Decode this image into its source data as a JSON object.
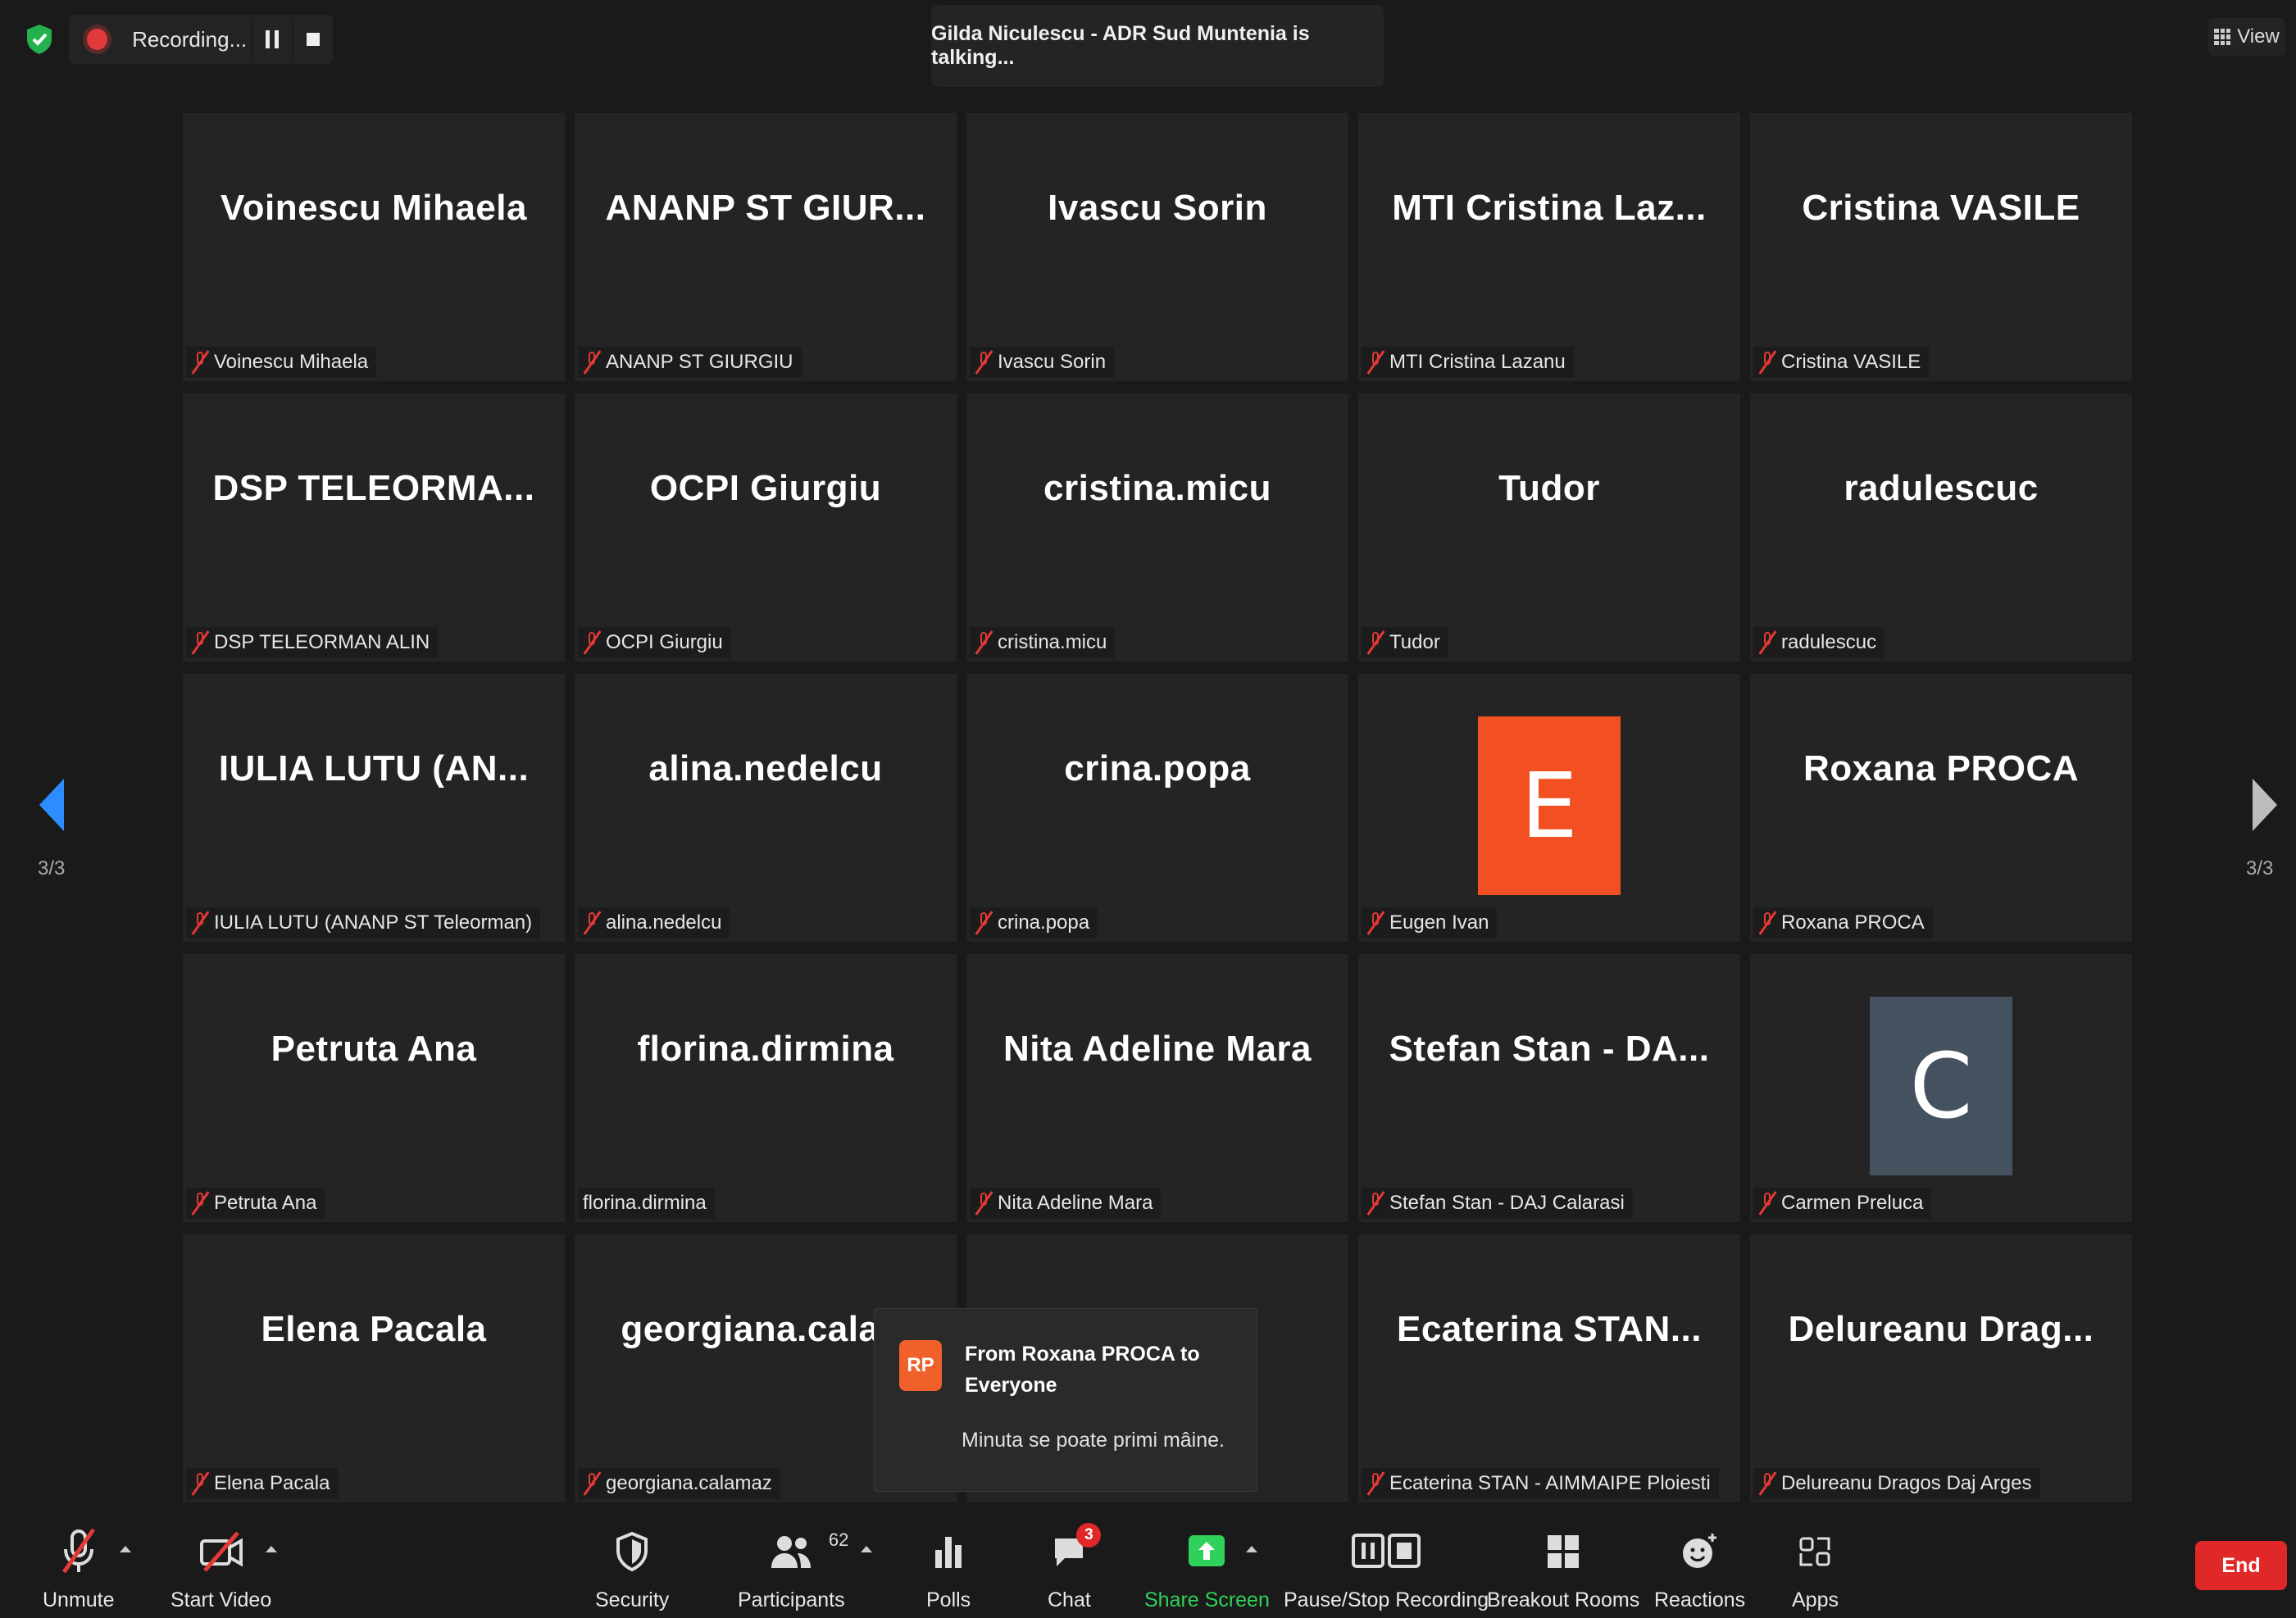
{
  "topbar": {
    "recording_label": "Recording...",
    "talking_banner": "Gilda Niculescu - ADR Sud Muntenia is talking...",
    "view_label": "View"
  },
  "navigation": {
    "left_page": "3/3",
    "right_page": "3/3"
  },
  "colors": {
    "accent_blue": "#2d8cff",
    "muted_red": "#e53935",
    "share_green": "#2fd15a",
    "end_red": "#e02828",
    "avatar_e": "#f25022",
    "avatar_c": "#44525f",
    "rp_badge": "#f0602a"
  },
  "tiles": [
    {
      "display": "Voinescu Mihaela",
      "tag": "Voinescu Mihaela",
      "muted": true
    },
    {
      "display": "ANANP ST GIUR...",
      "tag": "ANANP ST GIURGIU",
      "muted": true
    },
    {
      "display": "Ivascu Sorin",
      "tag": "Ivascu Sorin",
      "muted": true
    },
    {
      "display": "MTI Cristina Laz...",
      "tag": "MTI Cristina Lazanu",
      "muted": true
    },
    {
      "display": "Cristina VASILE",
      "tag": "Cristina VASILE",
      "muted": true
    },
    {
      "display": "DSP TELEORMA...",
      "tag": "DSP TELEORMAN ALIN",
      "muted": true
    },
    {
      "display": "OCPI Giurgiu",
      "tag": "OCPI Giurgiu",
      "muted": true
    },
    {
      "display": "cristina.micu",
      "tag": "cristina.micu",
      "muted": true
    },
    {
      "display": "Tudor",
      "tag": "Tudor",
      "muted": true
    },
    {
      "display": "radulescuc",
      "tag": "radulescuc",
      "muted": true
    },
    {
      "display": "IULIA LUTU (AN...",
      "tag": "IULIA LUTU (ANANP ST Teleorman)",
      "muted": true
    },
    {
      "display": "alina.nedelcu",
      "tag": "alina.nedelcu",
      "muted": true
    },
    {
      "display": "crina.popa",
      "tag": "crina.popa",
      "muted": true
    },
    {
      "avatar": "E",
      "avatar_color": "#f25022",
      "tag": "Eugen Ivan",
      "muted": true
    },
    {
      "display": "Roxana PROCA",
      "tag": "Roxana PROCA",
      "muted": true
    },
    {
      "display": "Petruta Ana",
      "tag": "Petruta Ana",
      "muted": true
    },
    {
      "display": "florina.dirmina",
      "tag": "florina.dirmina",
      "muted": false
    },
    {
      "display": "Nita Adeline Mara",
      "tag": "Nita Adeline Mara",
      "muted": true
    },
    {
      "display": "Stefan Stan - DA...",
      "tag": "Stefan Stan - DAJ Calarasi",
      "muted": true
    },
    {
      "avatar": "C",
      "avatar_color": "#44525f",
      "tag": "Carmen Preluca",
      "muted": true
    },
    {
      "display": "Elena Pacala",
      "tag": "Elena Pacala",
      "muted": true
    },
    {
      "display": "georgiana.cala...",
      "tag": "georgiana.calamaz",
      "muted": true
    },
    {
      "display": "",
      "tag": "",
      "muted": true
    },
    {
      "display": "Ecaterina STAN...",
      "tag": "Ecaterina STAN - AIMMAIPE Ploiesti",
      "muted": true
    },
    {
      "display": "Delureanu Drag...",
      "tag": "Delureanu Dragos Daj Arges",
      "muted": true
    }
  ],
  "chat_popup": {
    "initials": "RP",
    "from": "From Roxana PROCA to Everyone",
    "message": "Minuta se poate primi mâine."
  },
  "toolbar": {
    "unmute": "Unmute",
    "start_video": "Start Video",
    "security": "Security",
    "participants": "Participants",
    "participants_count": "62",
    "polls": "Polls",
    "chat": "Chat",
    "chat_badge": "3",
    "share_screen": "Share Screen",
    "pause_stop_recording": "Pause/Stop Recording",
    "breakout_rooms": "Breakout Rooms",
    "reactions": "Reactions",
    "apps": "Apps",
    "end": "End"
  }
}
